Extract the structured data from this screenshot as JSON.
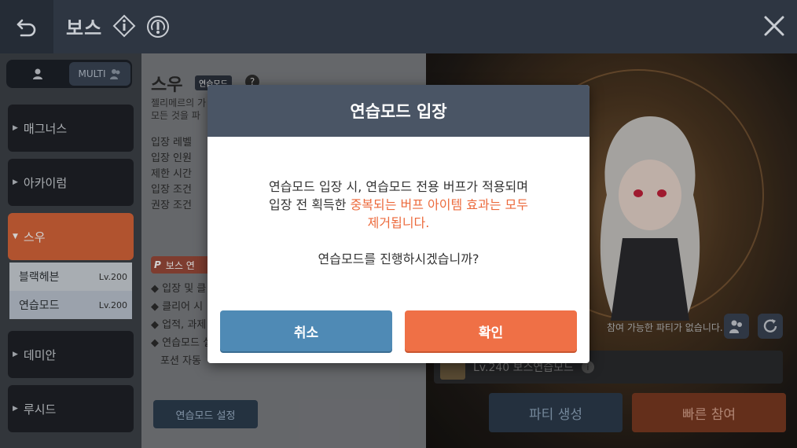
{
  "header": {
    "title": "보스",
    "icons": [
      "back-icon",
      "info-diamond-icon",
      "gauge-icon",
      "close-icon"
    ]
  },
  "sidebar": {
    "mode_toggle": {
      "multi_label": "MULTI"
    },
    "categories": [
      {
        "label": "매그너스",
        "expanded": false
      },
      {
        "label": "아카이럼",
        "expanded": false
      },
      {
        "label": "스우",
        "expanded": true
      },
      {
        "label": "데미안",
        "expanded": false
      },
      {
        "label": "루시드",
        "expanded": false
      }
    ],
    "sub_items": [
      {
        "label": "블랙헤븐",
        "level": "Lv.200"
      },
      {
        "label": "연습모드",
        "level": "Lv.200"
      }
    ]
  },
  "boss": {
    "name": "스우",
    "badge": "연습모드",
    "help": "?",
    "desc_line1": "젤리메르의 가",
    "desc_line2": "모든 것을 파",
    "info_labels": [
      "입장 레벨",
      "입장 인원",
      "제한 시간",
      "입장 조건",
      "권장 조건"
    ],
    "section_badge_p": "P",
    "section_badge_text": "보스 연",
    "bullets": [
      "입장 및 클",
      "클리어 시 !",
      "업적, 과제",
      "연습모드 설",
      "포션 자동"
    ],
    "practice_setting_btn": "연습모드 설정"
  },
  "party": {
    "no_party_text": "참여 가능한 파티가 없습니다.",
    "row_text": "Lv.240 보스연습모드",
    "create_btn": "파티 생성",
    "quick_join_btn": "빠른 참여"
  },
  "modal": {
    "title": "연습모드 입장",
    "line1": "연습모드 입장 시, 연습모드 전용 버프가 적용되며",
    "line2_prefix": "입장 전 획득한 ",
    "line2_warn": "중복되는 버프 아이템 효과는 모두",
    "line3_warn": "제거됩니다.",
    "question": "연습모드를 진행하시겠습니까?",
    "cancel": "취소",
    "confirm": "확인"
  },
  "colors": {
    "accent_orange": "#ef7046",
    "cancel_blue": "#4f8ab5",
    "modal_header": "#4a5565",
    "warn_text": "#ec6a3c"
  }
}
